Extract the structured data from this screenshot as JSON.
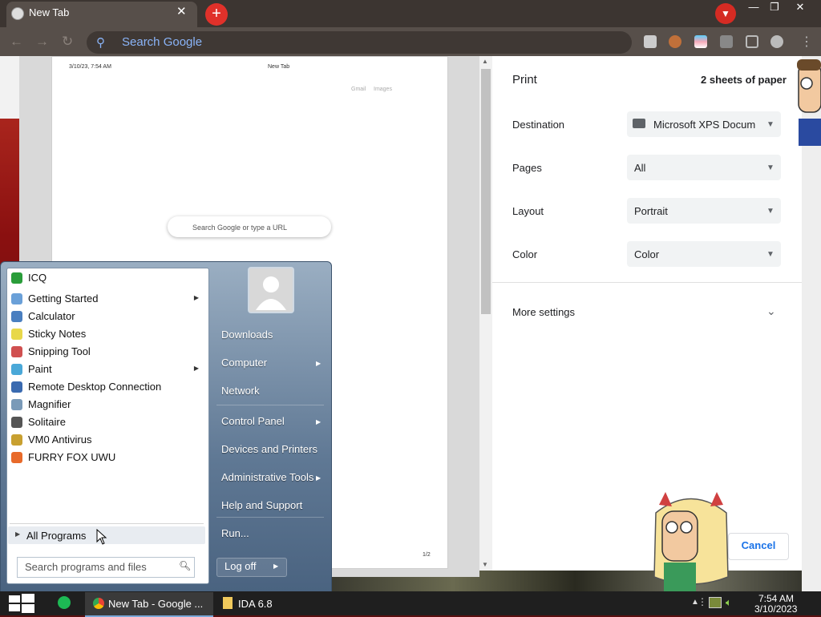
{
  "browser": {
    "tab_title": "New Tab",
    "omnibox_placeholder": "Search Google",
    "close_symbol": "✕",
    "new_tab_symbol": "+"
  },
  "preview": {
    "date": "3/10/23, 7:54 AM",
    "title": "New Tab",
    "gmail": "Gmail",
    "images": "Images",
    "search_text": "Search Google or type a URL",
    "page_number": "1/2"
  },
  "print_panel": {
    "title": "Print",
    "sheets": "2 sheets of paper",
    "rows": [
      {
        "label": "Destination",
        "value": "Microsoft XPS Docum"
      },
      {
        "label": "Pages",
        "value": "All"
      },
      {
        "label": "Layout",
        "value": "Portrait"
      },
      {
        "label": "Color",
        "value": "Color"
      }
    ],
    "more_settings": "More settings",
    "cancel": "Cancel"
  },
  "start_menu": {
    "programs": [
      {
        "label": "ICQ",
        "icon": "icq-icon",
        "color": "#2a9d3a",
        "submenu": false
      },
      {
        "label": "Getting Started",
        "icon": "getting-started-icon",
        "color": "#6aa0d8",
        "submenu": true
      },
      {
        "label": "Calculator",
        "icon": "calculator-icon",
        "color": "#4a7fc0",
        "submenu": false
      },
      {
        "label": "Sticky Notes",
        "icon": "sticky-notes-icon",
        "color": "#e8d84a",
        "submenu": false
      },
      {
        "label": "Snipping Tool",
        "icon": "snipping-tool-icon",
        "color": "#d05050",
        "submenu": false
      },
      {
        "label": "Paint",
        "icon": "paint-icon",
        "color": "#4aa8d8",
        "submenu": true
      },
      {
        "label": "Remote Desktop Connection",
        "icon": "remote-desktop-icon",
        "color": "#3a6ab0",
        "submenu": false
      },
      {
        "label": "Magnifier",
        "icon": "magnifier-icon",
        "color": "#7a9ab8",
        "submenu": false
      },
      {
        "label": "Solitaire",
        "icon": "solitaire-icon",
        "color": "#555555",
        "submenu": false
      },
      {
        "label": "VM0 Antivirus",
        "icon": "shield-icon",
        "color": "#c8a030",
        "submenu": false
      },
      {
        "label": "FURRY FOX UWU",
        "icon": "firefox-icon",
        "color": "#e86a2a",
        "submenu": false
      }
    ],
    "all_programs": "All Programs",
    "search_placeholder": "Search programs and files",
    "right_links": [
      {
        "label": "Downloads",
        "submenu": false
      },
      {
        "label": "Computer",
        "submenu": true
      },
      {
        "label": "Network",
        "submenu": false
      },
      {
        "label": "Control Panel",
        "submenu": true
      },
      {
        "label": "Devices and Printers",
        "submenu": false
      },
      {
        "label": "Administrative Tools",
        "submenu": true
      },
      {
        "label": "Help and Support",
        "submenu": false
      },
      {
        "label": "Run...",
        "submenu": false
      }
    ],
    "log_off": "Log off"
  },
  "taskbar": {
    "chrome_label": "New Tab - Google ...",
    "ida_label": "IDA 6.8",
    "time": "7:54 AM",
    "date": "3/10/2023"
  }
}
